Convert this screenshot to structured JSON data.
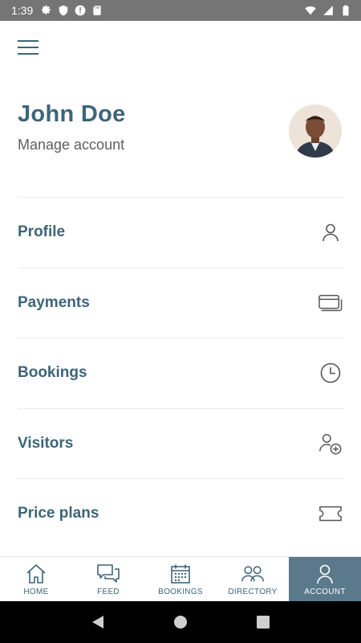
{
  "status_bar": {
    "time": "1:39",
    "icons": [
      "gear-icon",
      "shield-icon",
      "alert-icon",
      "sd-card-icon",
      "wifi-icon",
      "signal-icon",
      "battery-icon"
    ]
  },
  "header": {
    "menu_icon": "hamburger-menu-icon",
    "user_name": "John Doe",
    "manage_account_label": "Manage account",
    "avatar_icon": "user-avatar"
  },
  "menu": {
    "items": [
      {
        "label": "Profile",
        "icon": "person-icon"
      },
      {
        "label": "Payments",
        "icon": "cards-icon"
      },
      {
        "label": "Bookings",
        "icon": "clock-icon"
      },
      {
        "label": "Visitors",
        "icon": "add-person-icon"
      },
      {
        "label": "Price plans",
        "icon": "ticket-icon"
      }
    ]
  },
  "bottom_nav": {
    "items": [
      {
        "label": "HOME",
        "icon": "home-icon"
      },
      {
        "label": "FEED",
        "icon": "chat-icon"
      },
      {
        "label": "BOOKINGS",
        "icon": "calendar-icon"
      },
      {
        "label": "DIRECTORY",
        "icon": "people-icon"
      },
      {
        "label": "ACCOUNT",
        "icon": "person-icon"
      }
    ],
    "active": "ACCOUNT"
  },
  "system_nav": {
    "icons": [
      "back-icon",
      "home-circle-icon",
      "recents-icon"
    ]
  },
  "colors": {
    "accent": "#3d6578",
    "active_tab_bg": "#5a7a8b",
    "status_bar": "#757575",
    "secondary_text": "#5e5e5e"
  }
}
